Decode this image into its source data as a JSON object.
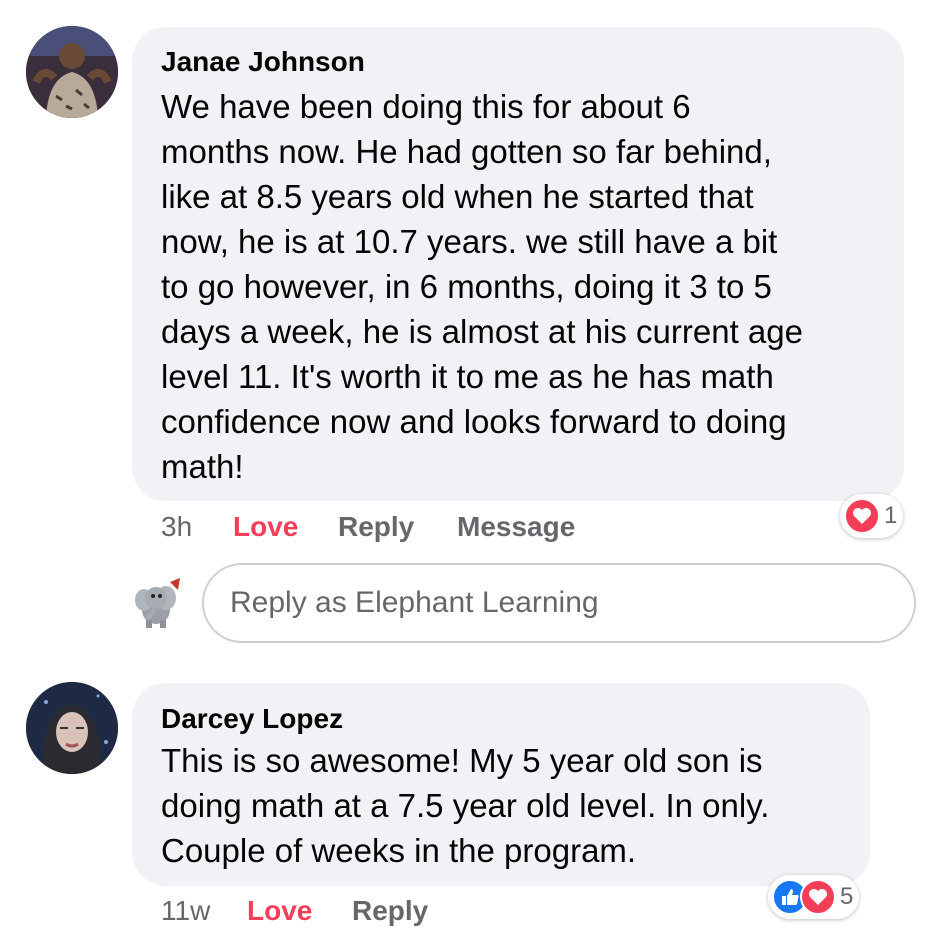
{
  "comments": [
    {
      "author": "Janae Johnson",
      "text": "We have been doing this for about 6\nmonths now. He had gotten so far behind,\nlike at 8.5 years old when he started that\nnow, he is at 10.7 years.  we still have a bit\nto go however, in 6 months, doing it 3 to 5\ndays a week, he is almost at his current age\nlevel 11. It's worth it to me as he has math\nconfidence now and looks forward to doing\nmath!",
      "time": "3h",
      "love_label": "Love",
      "reply_label": "Reply",
      "message_label": "Message",
      "reaction_count": "1",
      "reactions": [
        "heart-icon"
      ]
    },
    {
      "author": "Darcey Lopez",
      "text": "This is so awesome! My 5 year old son is\ndoing math at a 7.5 year old level.  In only.\nCouple of weeks in the program.",
      "time": "11w",
      "love_label": "Love",
      "reply_label": "Reply",
      "reaction_count": "5",
      "reactions": [
        "like-icon",
        "heart-icon"
      ]
    }
  ],
  "reply_box": {
    "placeholder": "Reply as Elephant Learning"
  },
  "colors": {
    "bubble": "#f0f2f5",
    "love": "#f33e58",
    "meta": "#65676b",
    "like": "#1877f2"
  }
}
